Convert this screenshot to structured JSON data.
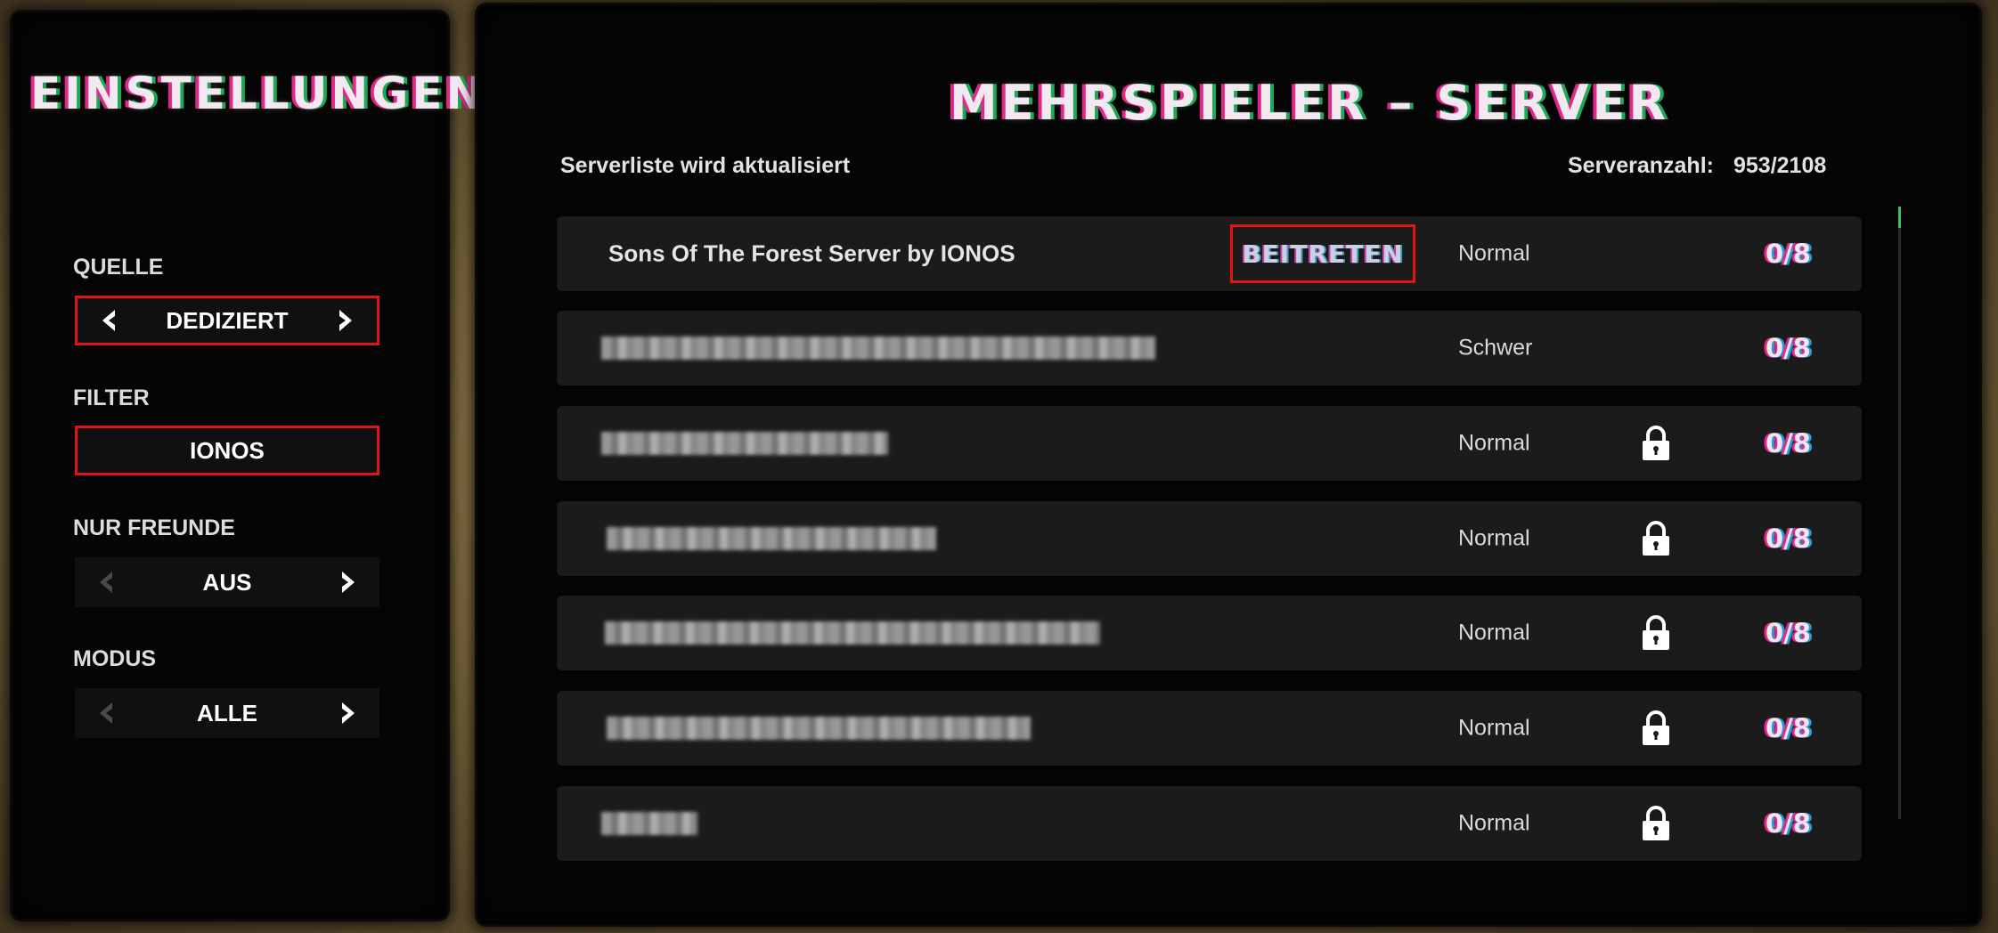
{
  "settings": {
    "title": "EINSTELLUNGEN",
    "source_label": "QUELLE",
    "source_value": "DEDIZIERT",
    "filter_label": "FILTER",
    "filter_value": "IONOS",
    "friends_label": "NUR FREUNDE",
    "friends_value": "AUS",
    "mode_label": "MODUS",
    "mode_value": "ALLE"
  },
  "serverlist": {
    "title": "MEHRSPIELER – SERVER",
    "status": "Serverliste wird aktualisiert",
    "count_label": "Serveranzahl:",
    "count_value": "953/2108",
    "join_label": "BEITRETEN",
    "rows": [
      {
        "name": "Sons Of The Forest Server by IONOS",
        "difficulty": "Normal",
        "players": "0/8"
      },
      {
        "difficulty": "Schwer",
        "players": "0/8"
      },
      {
        "difficulty": "Normal",
        "players": "0/8"
      },
      {
        "difficulty": "Normal",
        "players": "0/8"
      },
      {
        "difficulty": "Normal",
        "players": "0/8"
      },
      {
        "difficulty": "Normal",
        "players": "0/8"
      },
      {
        "difficulty": "Normal",
        "players": "0/8"
      }
    ]
  },
  "icons": {
    "arrow_left": "chevron-left-icon",
    "arrow_right": "chevron-right-icon",
    "lock": "lock-icon"
  },
  "colors": {
    "highlight": "#e01515",
    "glitch_pink": "#e0288a",
    "glitch_green": "#1fa858",
    "arrow_enabled": "#ffffff",
    "arrow_disabled": "#4a4a4a"
  }
}
